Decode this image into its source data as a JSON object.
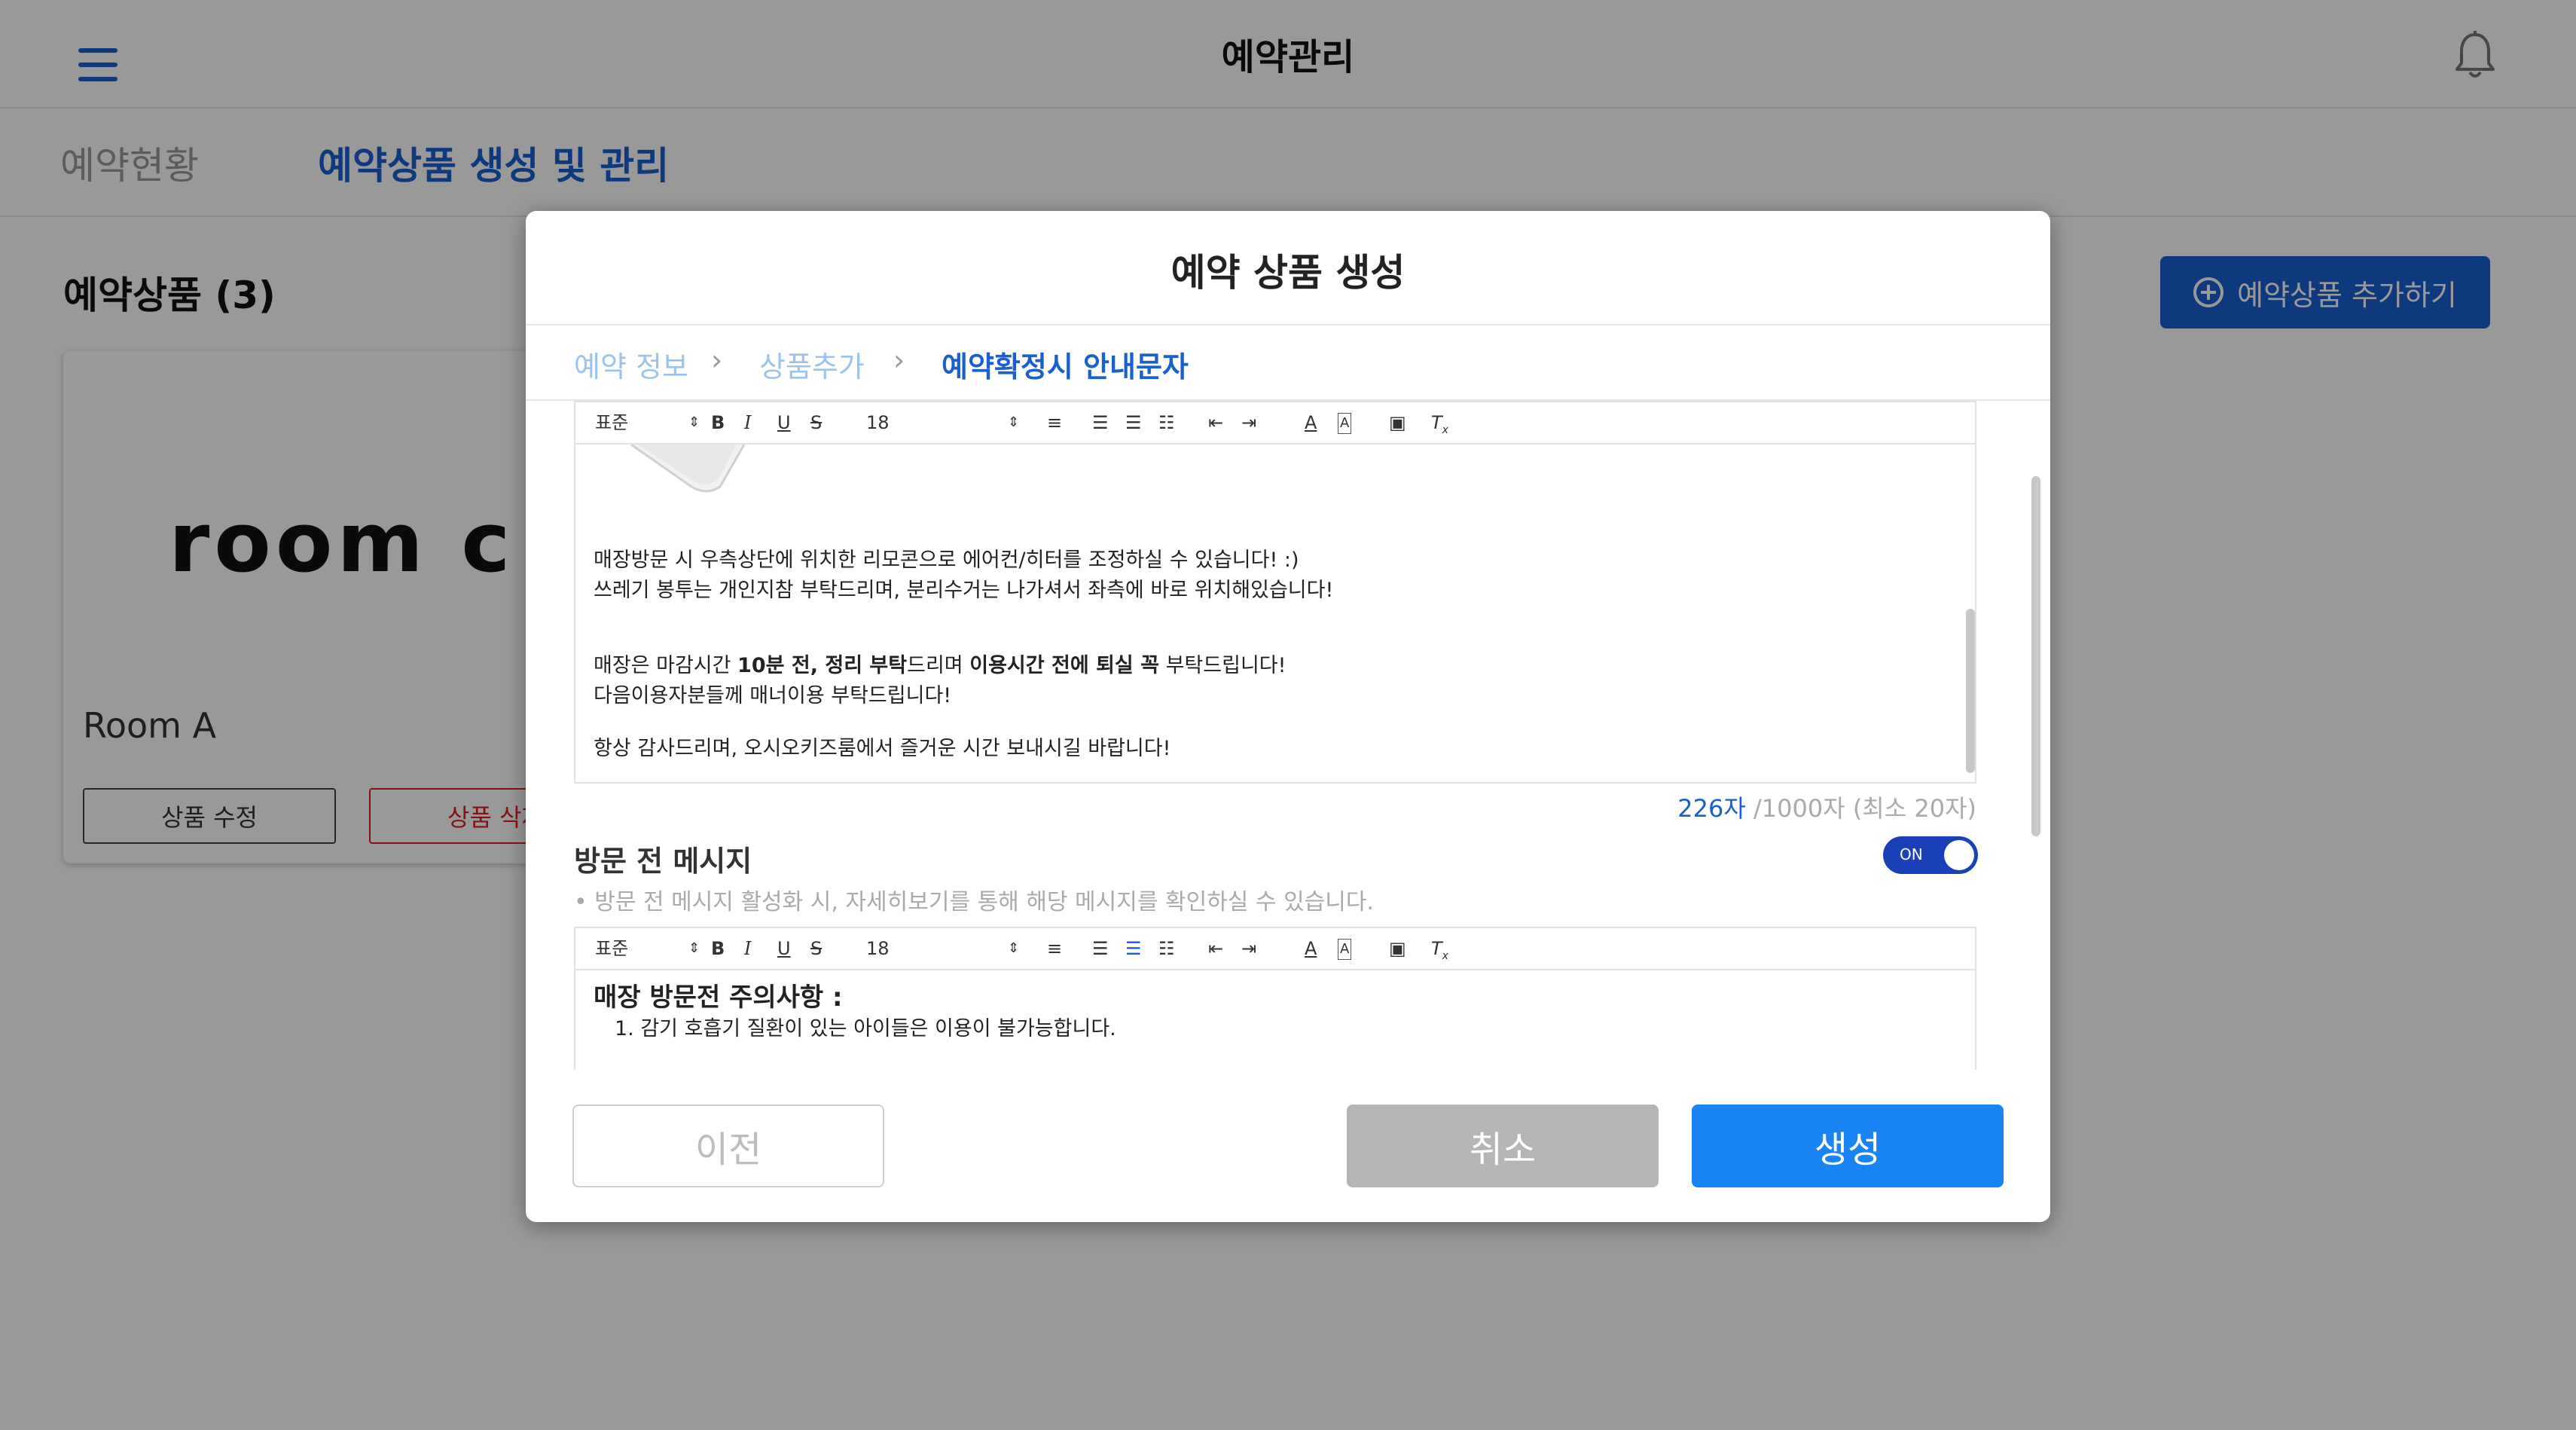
{
  "app": {
    "title": "예약관리",
    "tabs": [
      {
        "label": "예약현황"
      },
      {
        "label": "예약상품 생성 및 관리"
      }
    ],
    "section_title": "예약상품 (3)",
    "add_button_label": "예약상품 추가하기",
    "card": {
      "logo_text": "room c",
      "name": "Room A",
      "edit_label": "상품 수정",
      "delete_label": "상품 삭제"
    }
  },
  "modal": {
    "title": "예약 상품 생성",
    "steps": [
      {
        "label": "예약 정보"
      },
      {
        "label": "상품추가"
      },
      {
        "label": "예약확정시 안내문자"
      }
    ],
    "toolbar": {
      "format": "표준",
      "font_size": "18"
    },
    "confirm_editor": {
      "lines": [
        "매장방문 시 우측상단에 위치한 리모콘으로 에어컨/히터를 조정하실 수 있습니다! :)",
        "쓰레기 봉투는 개인지참 부탁드리며, 분리수거는 나가셔서 좌측에 바로 위치해있습니다!"
      ],
      "closing_line": {
        "p1": "매장은 마감시간 ",
        "b1": "10분 전, 정리 부탁",
        "p2": "드리며 ",
        "b2": "이용시간 전에 퇴실 꼭",
        "p3": " 부탁드립니다!"
      },
      "line_manner": "다음이용자분들께 매너이용 부탁드립니다!",
      "line_thanks": "항상 감사드리며, 오시오키즈룸에서 즐거운 시간 보내시길 바랍니다!"
    },
    "counter": {
      "current": "226자",
      "rest": " /1000자 (최소 20자)"
    },
    "pre_visit": {
      "title": "방문 전 메시지",
      "toggle_label": "ON",
      "toggle_on": true,
      "hint": "• 방문 전 메시지 활성화 시, 자세히보기를 통해 해당 메시지를 확인하실 수 있습니다.",
      "heading": "매장 방문전 주의사항 :",
      "item_1": "1. 감기 호흡기 질환이 있는 아이들은 이용이 불가능합니다."
    },
    "footer": {
      "prev_label": "이전",
      "cancel_label": "취소",
      "create_label": "생성"
    }
  },
  "colors": {
    "accent": "#1a5fd0",
    "primary_button": "#1a84f4",
    "toggle": "#1a40b8",
    "danger": "#e02020",
    "overlay": "rgba(0,0,0,0.40)"
  }
}
